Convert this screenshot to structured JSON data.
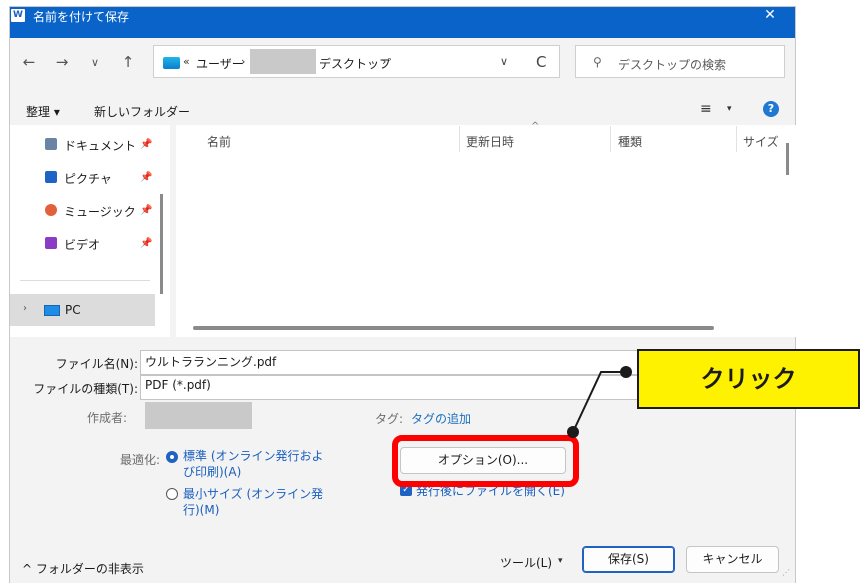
{
  "window": {
    "app_icon": "W",
    "title": "名前を付けて保存",
    "close_glyph": "✕"
  },
  "nav": {
    "back_glyph": "←",
    "forward_glyph": "→",
    "recent_glyph": "∨",
    "up_glyph": "↑",
    "breadcrumb": {
      "prefix": "«",
      "user": "ユーザー",
      "separator": "›",
      "desktop": "デスクトップ"
    },
    "dropdown_glyph": "∨",
    "refresh_glyph": "C",
    "search_icon_glyph": "⚲",
    "search_placeholder": "デスクトップの検索"
  },
  "toolbar": {
    "organize": "整理 ▾",
    "new_folder": "新しいフォルダー",
    "view_glyph": "≡",
    "view_drop_glyph": "▾",
    "help_glyph": "?"
  },
  "sidebar": {
    "pin_glyph": "📌",
    "items": [
      {
        "label": "ドキュメント",
        "icon": "documents-icon",
        "color": "#6b84a6"
      },
      {
        "label": "ピクチャ",
        "icon": "pictures-icon",
        "color": "#1f63c6"
      },
      {
        "label": "ミュージック",
        "icon": "music-icon",
        "color": "#e2603a"
      },
      {
        "label": "ビデオ",
        "icon": "video-icon",
        "color": "#8a3cc6"
      }
    ],
    "pc": {
      "chevron": "›",
      "label": "PC"
    }
  },
  "filelist": {
    "columns": [
      "名前",
      "更新日時",
      "種類",
      "サイズ"
    ],
    "sort_caret": "^"
  },
  "form": {
    "filename_label": "ファイル名(N):",
    "filename_value": "ウルトラランニング.pdf",
    "filetype_label": "ファイルの種類(T):",
    "filetype_value": "PDF (*.pdf)",
    "author_label": "作成者:",
    "tag_label": "タグ:",
    "tag_value": "タグの追加",
    "optimize_label": "最適化:",
    "option_standard_line1": "標準 (オンライン発行およ",
    "option_standard_line2": "び印刷)(A)",
    "option_min_line1": "最小サイズ (オンライン発",
    "option_min_line2": "行)(M)",
    "options_button": "オプション(O)...",
    "open_after": "発行後にファイルを開く(E)",
    "check_glyph": "✓"
  },
  "footer": {
    "hide_folders": "^ フォルダーの非表示",
    "tools": "ツール(L)",
    "tools_drop": "▾",
    "save": "保存(S)",
    "cancel": "キャンセル",
    "grip": "⋰"
  },
  "annotation": {
    "callout": "クリック",
    "callout_color": "#fff200",
    "frame_color": "#ff0000"
  }
}
